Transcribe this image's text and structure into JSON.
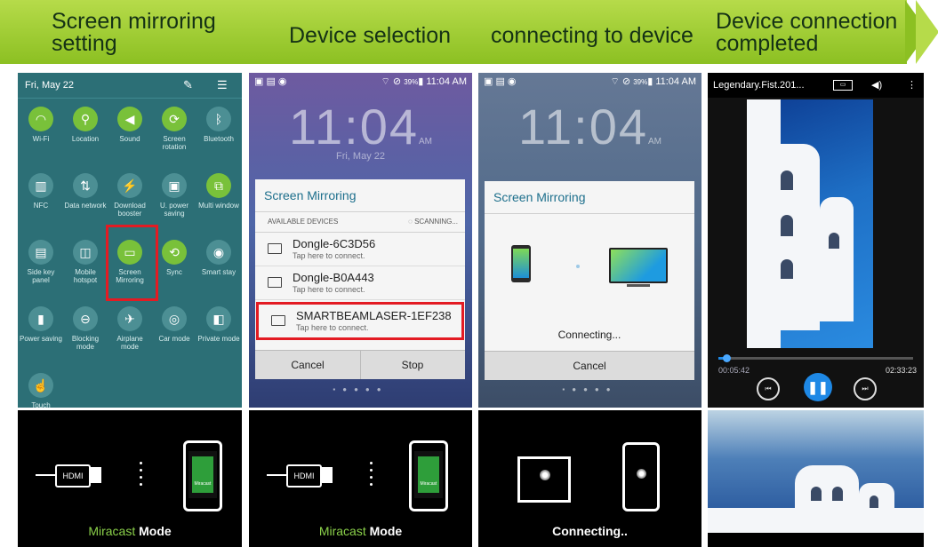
{
  "steps": [
    {
      "line1": "Screen mirroring",
      "line2": "setting"
    },
    {
      "line1": "Device selection"
    },
    {
      "line1": "connecting to device"
    },
    {
      "line1": "Device connection",
      "line2": "completed"
    }
  ],
  "quick_settings": {
    "date": "Fri, May 22",
    "items": [
      {
        "label": "Wi-Fi",
        "icon": "wifi-icon",
        "on": true
      },
      {
        "label": "Location",
        "icon": "location-icon",
        "on": true
      },
      {
        "label": "Sound",
        "icon": "sound-icon",
        "on": true
      },
      {
        "label": "Screen rotation",
        "icon": "rotation-icon",
        "on": true
      },
      {
        "label": "Bluetooth",
        "icon": "bluetooth-icon",
        "on": false
      },
      {
        "label": "NFC",
        "icon": "nfc-icon",
        "on": false
      },
      {
        "label": "Data network",
        "icon": "data-icon",
        "on": false
      },
      {
        "label": "Download booster",
        "icon": "download-booster-icon",
        "on": false
      },
      {
        "label": "U. power saving",
        "icon": "power-saving-icon",
        "on": false
      },
      {
        "label": "Multi window",
        "icon": "multi-window-icon",
        "on": true
      },
      {
        "label": "Side key panel",
        "icon": "side-key-icon",
        "on": false
      },
      {
        "label": "Mobile hotspot",
        "icon": "hotspot-icon",
        "on": false
      },
      {
        "label": "Screen Mirroring",
        "icon": "screen-mirroring-icon",
        "on": true
      },
      {
        "label": "Sync",
        "icon": "sync-icon",
        "on": true
      },
      {
        "label": "Smart stay",
        "icon": "smart-stay-icon",
        "on": false
      },
      {
        "label": "Power saving",
        "icon": "battery-icon",
        "on": false
      },
      {
        "label": "Blocking mode",
        "icon": "blocking-icon",
        "on": false
      },
      {
        "label": "Airplane mode",
        "icon": "airplane-icon",
        "on": false
      },
      {
        "label": "Car mode",
        "icon": "car-icon",
        "on": false
      },
      {
        "label": "Private mode",
        "icon": "private-icon",
        "on": false
      },
      {
        "label": "Touch",
        "icon": "touch-icon",
        "on": false
      }
    ]
  },
  "device_selection": {
    "status_time": "11:04 AM",
    "battery": "39%",
    "clock": "11:04",
    "clock_ampm": "AM",
    "clock_date": "Fri, May 22",
    "dialog_title": "Screen Mirroring",
    "available_label": "AVAILABLE DEVICES",
    "scanning_label": "SCANNING...",
    "devices": [
      {
        "name": "Dongle-6C3D56",
        "sub": "Tap here to connect."
      },
      {
        "name": "Dongle-B0A443",
        "sub": "Tap here to connect."
      },
      {
        "name": "SMARTBEAMLASER-1EF238",
        "sub": "Tap here to connect."
      }
    ],
    "cancel": "Cancel",
    "stop": "Stop"
  },
  "connecting": {
    "status_time": "11:04 AM",
    "battery": "39%",
    "clock": "11:04",
    "clock_ampm": "AM",
    "dialog_title": "Screen Mirroring",
    "status": "Connecting...",
    "cancel": "Cancel"
  },
  "player": {
    "title": "Legendary.Fist.201...",
    "elapsed": "00:05:42",
    "total": "02:33:23",
    "progress": 0.04
  },
  "bottom": [
    {
      "hdmi": "HDMI",
      "phone_label": "Miracast",
      "mode_a": "Miracast",
      "mode_b": " Mode"
    },
    {
      "hdmi": "HDMI",
      "phone_label": "Miracast",
      "mode_a": "Miracast",
      "mode_b": " Mode"
    },
    {
      "mode_b": "Connecting.."
    }
  ],
  "colors": {
    "banner": "#8cc022",
    "highlight": "#e31b23",
    "miracast_green": "#8bd14a",
    "player_accent": "#1e88e5"
  }
}
